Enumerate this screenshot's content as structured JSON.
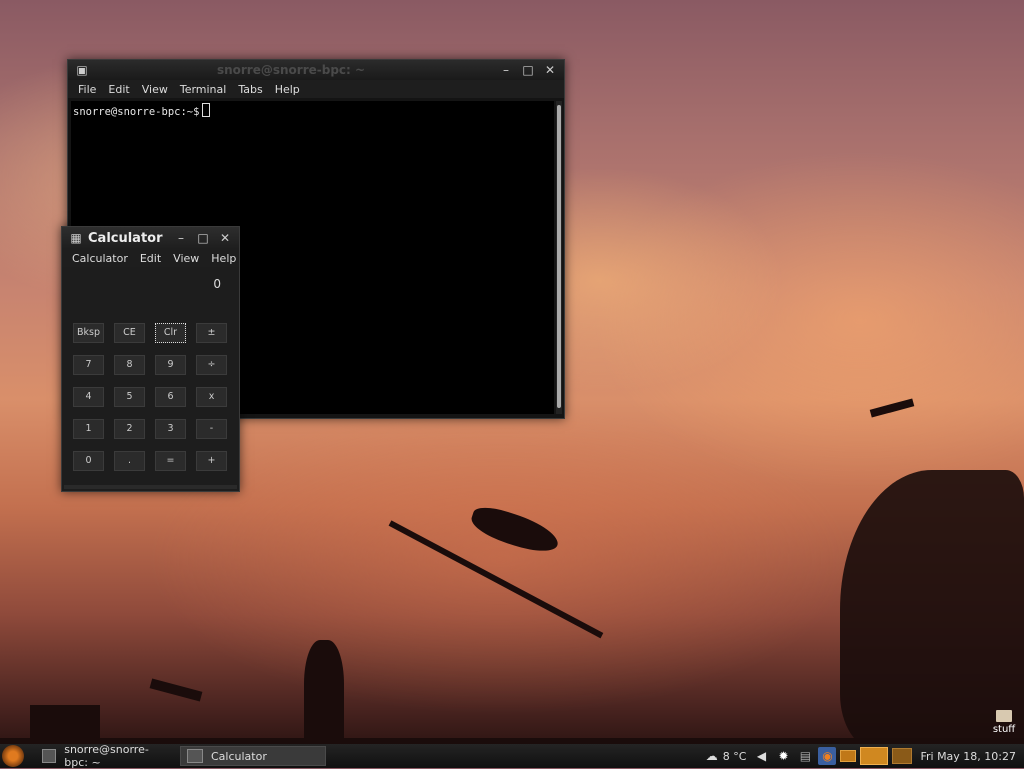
{
  "terminal": {
    "title": "snorre@snorre-bpc: ~",
    "menu": [
      "File",
      "Edit",
      "View",
      "Terminal",
      "Tabs",
      "Help"
    ],
    "prompt": "snorre@snorre-bpc:~$"
  },
  "calculator": {
    "title": "Calculator",
    "menu": [
      "Calculator",
      "Edit",
      "View",
      "Help"
    ],
    "display": "0",
    "keys": [
      "Bksp",
      "CE",
      "Clr",
      "±",
      "7",
      "8",
      "9",
      "÷",
      "4",
      "5",
      "6",
      "x",
      "1",
      "2",
      "3",
      "-",
      "0",
      ".",
      "=",
      "+"
    ]
  },
  "taskbar": {
    "tasks": [
      "snorre@snorre-bpc: ~",
      "Calculator"
    ],
    "weather": "8 °C",
    "clock": "Fri May 18, 10:27"
  },
  "desktop": {
    "folder_label": "stuff"
  }
}
